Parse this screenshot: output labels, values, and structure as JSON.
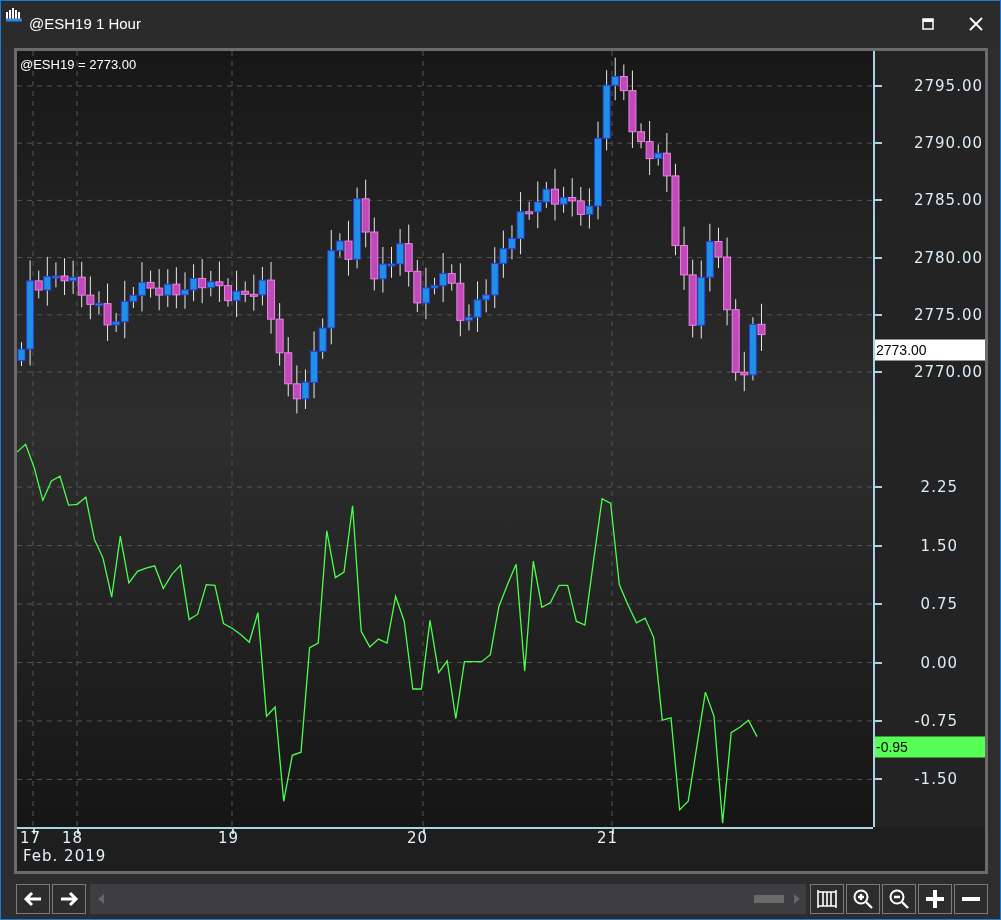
{
  "window": {
    "title": "@ESH19 1 Hour"
  },
  "price_pane": {
    "legend": "@ESH19 = 2773.00",
    "axis_labels": [
      "2795.00",
      "2790.00",
      "2785.00",
      "2780.00",
      "2775.00",
      "2770.00"
    ],
    "last_price": "2773.00"
  },
  "oscillator_pane": {
    "last_value": "-0.95",
    "chart_data": {
      "type": "line",
      "series": [
        {
          "color": "#4cff4c",
          "values": [
            2.7,
            2.8,
            2.5,
            2.08,
            2.33,
            2.39,
            2.02,
            2.03,
            2.12,
            1.58,
            1.34,
            0.84,
            1.62,
            1.02,
            1.17,
            1.21,
            1.24,
            0.95,
            1.13,
            1.25,
            0.55,
            0.62,
            1.0,
            0.99,
            0.5,
            0.44,
            0.36,
            0.26,
            0.64,
            -0.69,
            -0.57,
            -1.78,
            -1.19,
            -1.15,
            0.19,
            0.25,
            1.69,
            1.09,
            1.16,
            2.01,
            0.4,
            0.2,
            0.3,
            0.25,
            0.85,
            0.53,
            -0.34,
            -0.34,
            0.54,
            -0.13,
            0.02,
            -0.72,
            0.01,
            0.01,
            0.01,
            0.1,
            0.72,
            1.0,
            1.26,
            -0.11,
            1.3,
            0.71,
            0.77,
            0.99,
            0.99,
            0.53,
            0.48,
            1.3,
            2.1,
            2.04,
            1.0,
            0.74,
            0.51,
            0.57,
            0.32,
            -0.74,
            -0.71,
            -1.89,
            -1.78,
            -1.08,
            -0.38,
            -0.69,
            -2.06,
            -0.9,
            -0.83,
            -0.74,
            -0.95
          ]
        }
      ],
      "ylim": [
        -2.11,
        2.97
      ],
      "grid": true,
      "yticks": [
        {
          "value": 2.25,
          "label": "2.25"
        },
        {
          "value": 1.5,
          "label": "1.50"
        },
        {
          "value": 0.75,
          "label": "0.75"
        },
        {
          "value": 0,
          "label": "0.00"
        },
        {
          "value": -0.75,
          "label": "-0.75"
        },
        {
          "value": -1.5,
          "label": "-1.50"
        }
      ]
    }
  },
  "date_axis": {
    "labels": [
      "17",
      "18",
      "19",
      "20",
      "21"
    ],
    "period": "Feb. 2019"
  }
}
